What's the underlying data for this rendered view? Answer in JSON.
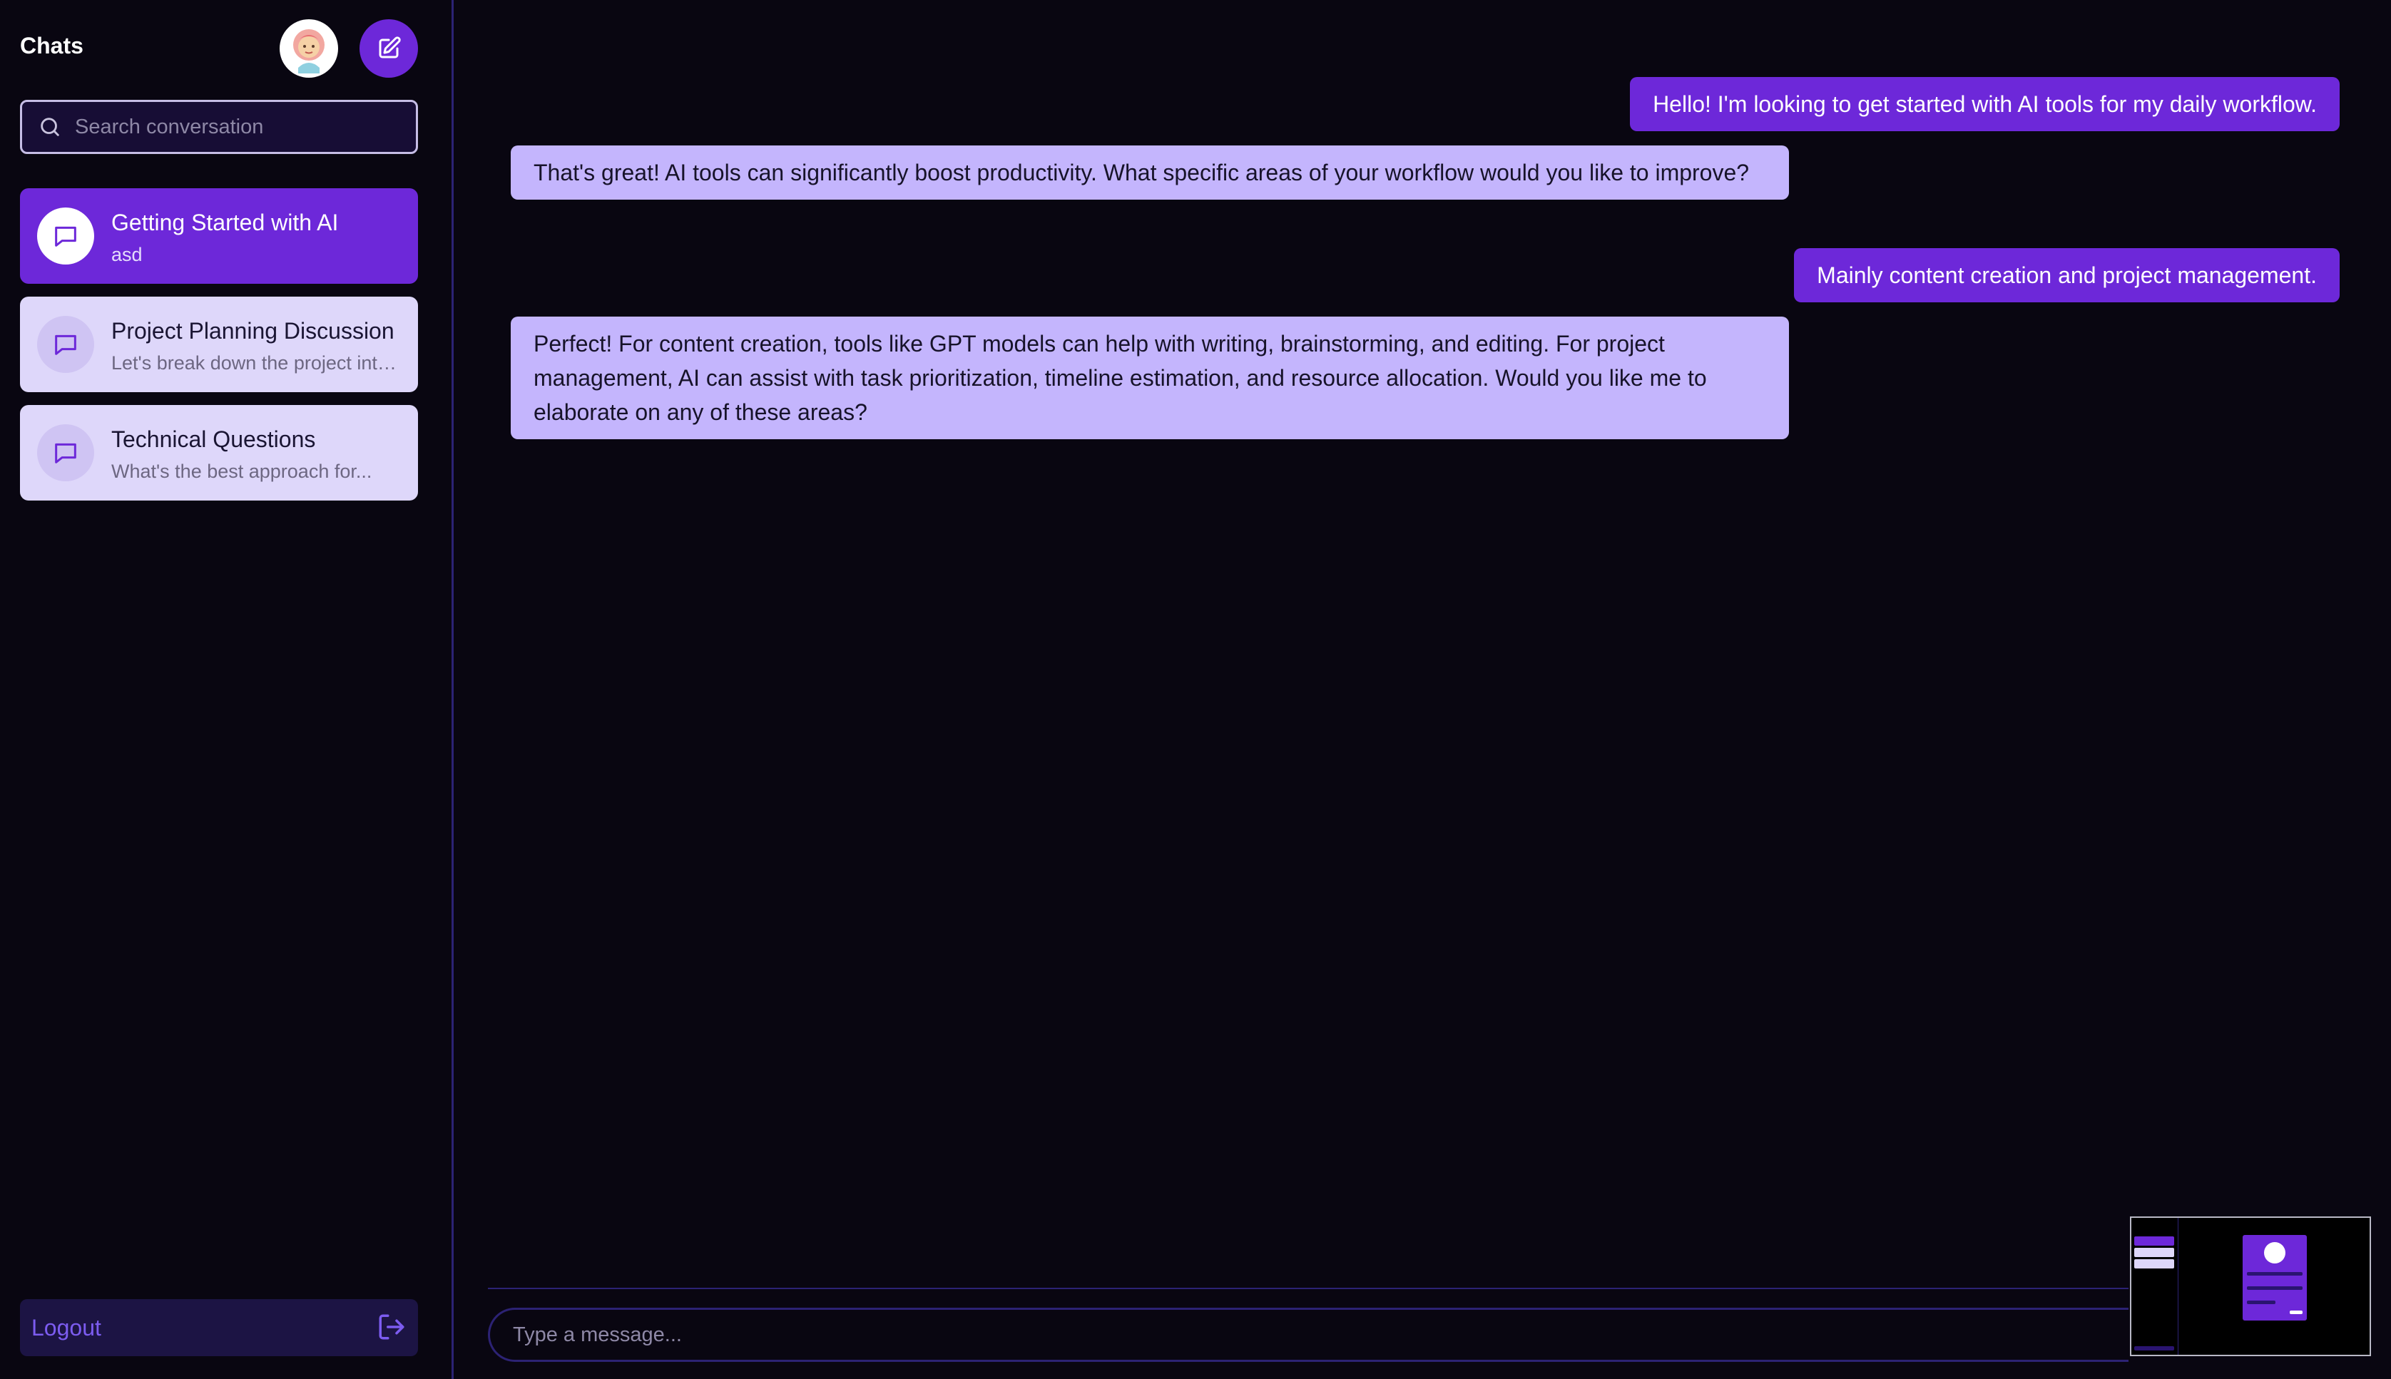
{
  "sidebar": {
    "title": "Chats",
    "search_placeholder": "Search conversation",
    "conversations": [
      {
        "title": "Getting Started with AI",
        "preview": "asd",
        "active": true
      },
      {
        "title": "Project Planning Discussion",
        "preview": "Let's break down the project into phases",
        "active": false
      },
      {
        "title": "Technical Questions",
        "preview": "What's the best approach for...",
        "active": false
      }
    ],
    "logout_label": "Logout"
  },
  "messages": [
    {
      "role": "user",
      "text": "Hello! I'm looking to get started with AI tools for my daily workflow."
    },
    {
      "role": "assistant",
      "text": "That's great! AI tools can significantly boost productivity. What specific areas of your workflow would you like to improve?"
    },
    {
      "role": "user",
      "text": "Mainly content creation and project management."
    },
    {
      "role": "assistant",
      "text": "Perfect! For content creation, tools like GPT models can help with writing, brainstorming, and editing. For project management, AI can assist with task prioritization, timeline estimation, and resource allocation. Would you like me to elaborate on any of these areas?"
    }
  ],
  "composer": {
    "placeholder": "Type a message..."
  },
  "icons": {
    "avatar": "user-avatar",
    "new_chat": "edit-icon",
    "search": "search-icon",
    "conversation": "message-square-icon",
    "logout": "logout-icon"
  },
  "colors": {
    "accent": "#6d28d9",
    "assistant_bubble": "#c4b5fd",
    "background": "#090611",
    "inactive_item": "#ded7fa"
  }
}
